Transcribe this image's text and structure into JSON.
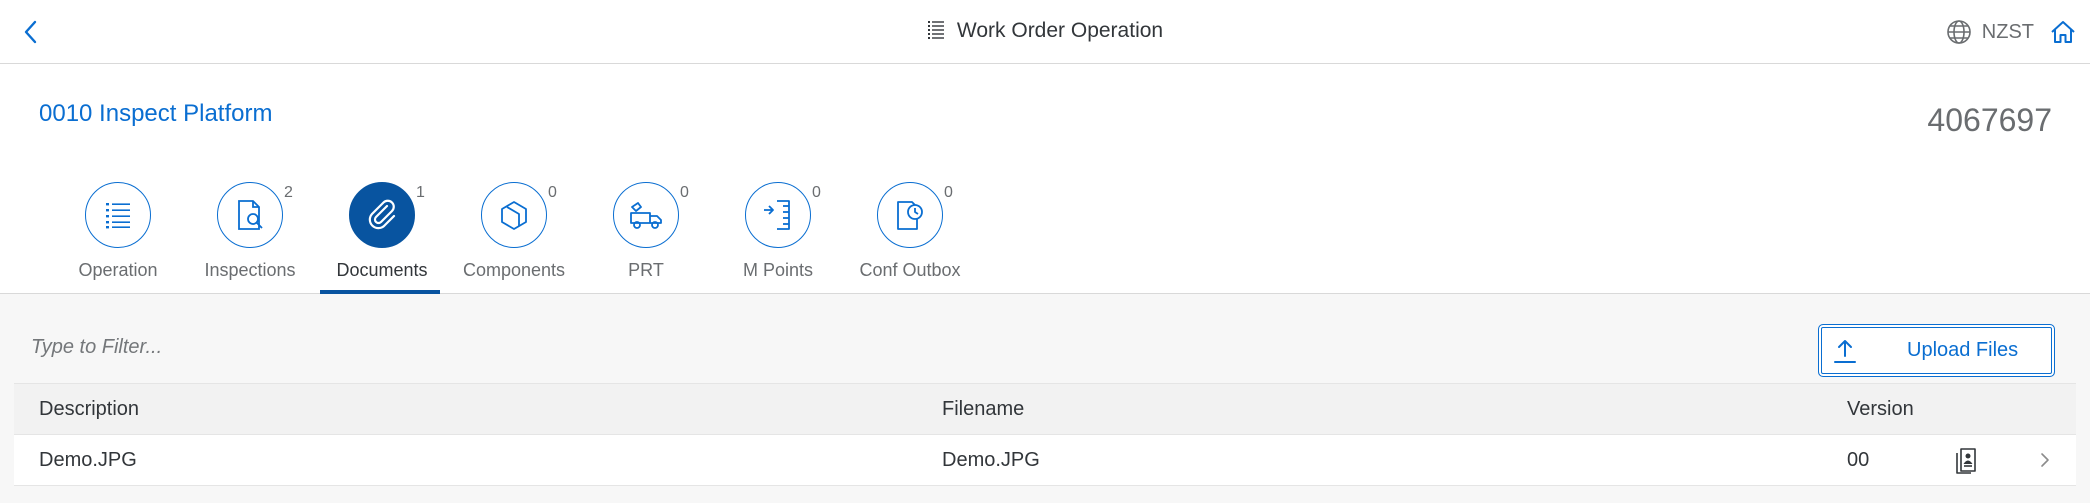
{
  "shell": {
    "title": "Work Order Operation",
    "region": "NZST"
  },
  "header": {
    "title": "0010 Inspect Platform",
    "number": "4067697"
  },
  "tabs": [
    {
      "label": "Operation",
      "count": "",
      "icon": "list-icon",
      "active": false
    },
    {
      "label": "Inspections",
      "count": "2",
      "icon": "inspection-icon",
      "active": false
    },
    {
      "label": "Documents",
      "count": "1",
      "icon": "paperclip-icon",
      "active": true
    },
    {
      "label": "Components",
      "count": "0",
      "icon": "component-icon",
      "active": false
    },
    {
      "label": "PRT",
      "count": "0",
      "icon": "tool-truck-icon",
      "active": false
    },
    {
      "label": "M Points",
      "count": "0",
      "icon": "measure-point-icon",
      "active": false
    },
    {
      "label": "Conf Outbox",
      "count": "0",
      "icon": "outbox-clock-icon",
      "active": false
    }
  ],
  "filter": {
    "placeholder": "Type to Filter..."
  },
  "upload": {
    "label": "Upload Files"
  },
  "table": {
    "columns": [
      "Description",
      "Filename",
      "Version"
    ],
    "rows": [
      {
        "description": "Demo.JPG",
        "filename": "Demo.JPG",
        "version": "00"
      }
    ]
  },
  "colors": {
    "accent": "#0a6ed1",
    "active": "#0854a0",
    "text": "#32363a",
    "muted": "#6a6d70",
    "background": "#f7f7f7"
  }
}
